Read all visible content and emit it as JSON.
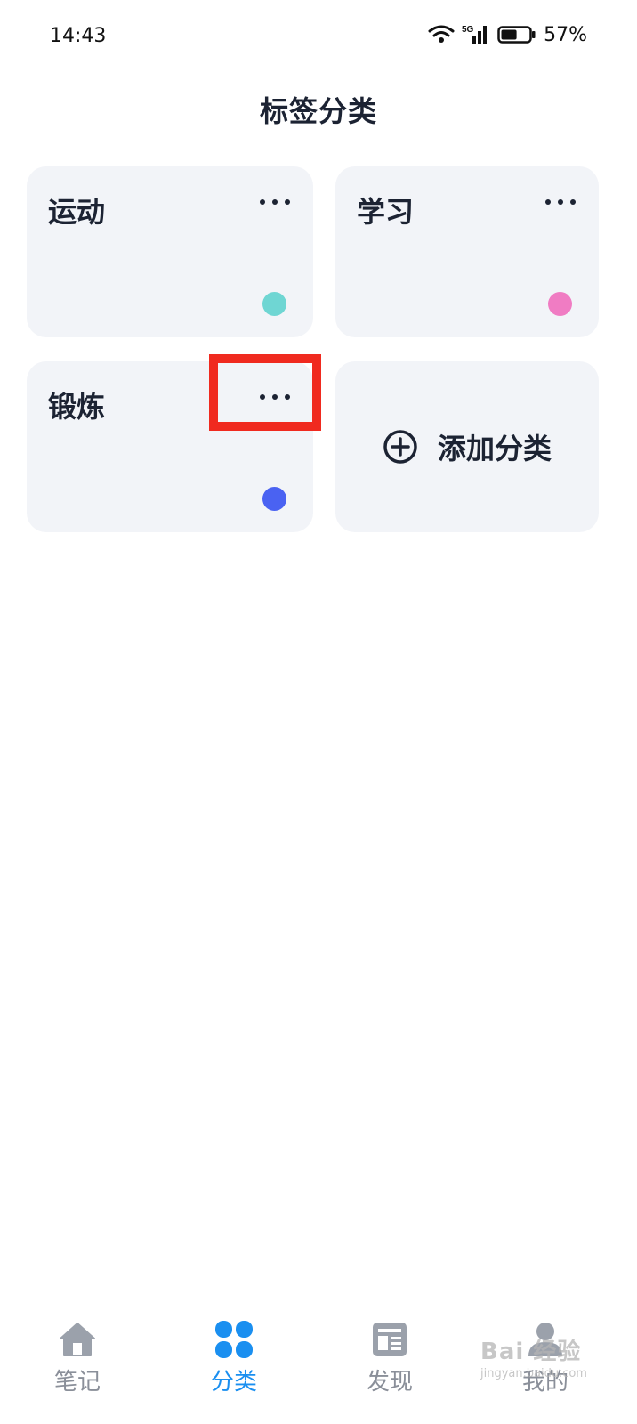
{
  "status_bar": {
    "time": "14:43",
    "battery_percent": "57%",
    "network": "5G",
    "battery_level": 0.57
  },
  "header": {
    "title": "标签分类"
  },
  "categories": [
    {
      "name": "运动",
      "color": "#6fd6d3"
    },
    {
      "name": "学习",
      "color": "#f07cc3"
    },
    {
      "name": "锻炼",
      "color": "#4a62f2"
    }
  ],
  "add_category": {
    "label": "添加分类",
    "icon": "plus-circle-icon"
  },
  "tabbar": {
    "items": [
      {
        "label": "笔记",
        "icon": "home-icon",
        "active": false
      },
      {
        "label": "分类",
        "icon": "grid-icon",
        "active": true
      },
      {
        "label": "发现",
        "icon": "news-icon",
        "active": false
      },
      {
        "label": "我的",
        "icon": "profile-icon",
        "active": false
      }
    ]
  },
  "colors": {
    "accent": "#1a8ff0",
    "card_bg": "#f2f4f8",
    "highlight": "#f02a1f"
  },
  "watermark": {
    "text": "Bai 经验",
    "sub": "jingyan.baidu.com"
  }
}
